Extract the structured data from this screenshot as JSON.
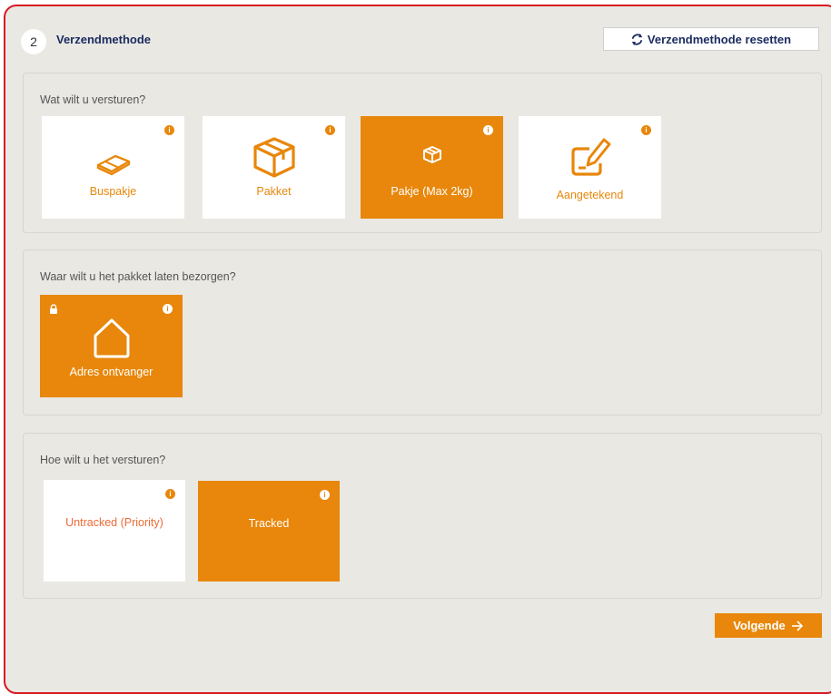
{
  "step": {
    "number": "2",
    "title": "Verzendmethode"
  },
  "reset": {
    "label": "Verzendmethode resetten",
    "icon": "refresh-icon"
  },
  "colors": {
    "accent": "#e8870b",
    "brand_red": "#d71921",
    "navy": "#1a2a5e"
  },
  "what": {
    "question": "Wat wilt u versturen?",
    "options": [
      {
        "label": "Buspakje",
        "icon": "letterbox-package-icon",
        "selected": false
      },
      {
        "label": "Pakket",
        "icon": "package-icon",
        "selected": false
      },
      {
        "label": "Pakje (Max 2kg)",
        "icon": "small-package-icon",
        "selected": true
      },
      {
        "label": "Aangetekend",
        "icon": "signature-icon",
        "selected": false
      }
    ]
  },
  "where": {
    "question": "Waar wilt u het pakket laten bezorgen?",
    "options": [
      {
        "label": "Adres ontvanger",
        "icon": "house-icon",
        "selected": true,
        "locked": true
      }
    ]
  },
  "how": {
    "question": "Hoe wilt u het versturen?",
    "options": [
      {
        "label": "Untracked (Priority)",
        "selected": false
      },
      {
        "label": "Tracked",
        "selected": true
      }
    ]
  },
  "next": {
    "label": "Volgende",
    "icon": "arrow-right-icon"
  }
}
